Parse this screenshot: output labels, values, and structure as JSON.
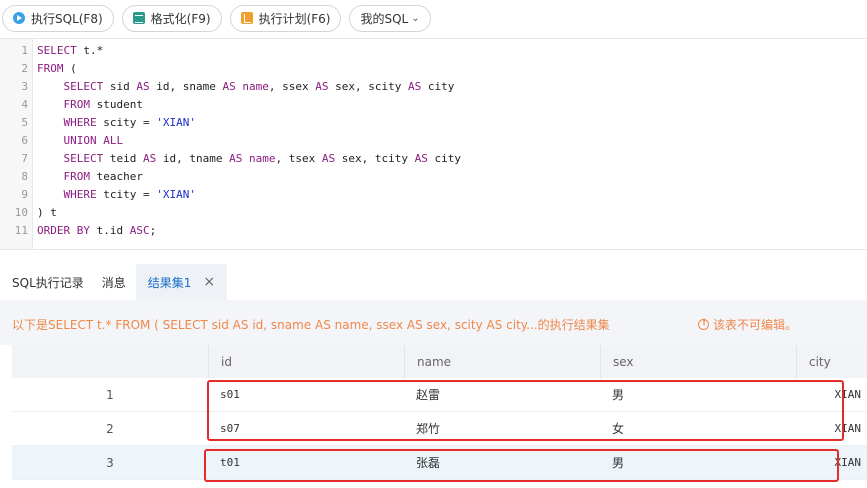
{
  "toolbar": {
    "run_label": "执行SQL(F8)",
    "format_label": "格式化(F9)",
    "plan_label": "执行计划(F6)",
    "mysql_label": "我的SQL"
  },
  "editor": {
    "lines": [
      {
        "n": "1",
        "tokens": [
          [
            "kw",
            "SELECT"
          ],
          [
            "t",
            " t.*"
          ]
        ]
      },
      {
        "n": "2",
        "tokens": [
          [
            "kw",
            "FROM"
          ],
          [
            "t",
            " ("
          ]
        ]
      },
      {
        "n": "3",
        "tokens": [
          [
            "t",
            "    "
          ],
          [
            "kw",
            "SELECT"
          ],
          [
            "t",
            " sid "
          ],
          [
            "kw",
            "AS"
          ],
          [
            "t",
            " id, sname "
          ],
          [
            "kw",
            "AS"
          ],
          [
            "t",
            " "
          ],
          [
            "kw",
            "name"
          ],
          [
            "t",
            ", ssex "
          ],
          [
            "kw",
            "AS"
          ],
          [
            "t",
            " sex, scity "
          ],
          [
            "kw",
            "AS"
          ],
          [
            "t",
            " city"
          ]
        ]
      },
      {
        "n": "4",
        "tokens": [
          [
            "t",
            "    "
          ],
          [
            "kw",
            "FROM"
          ],
          [
            "t",
            " student"
          ]
        ]
      },
      {
        "n": "5",
        "tokens": [
          [
            "t",
            "    "
          ],
          [
            "kw",
            "WHERE"
          ],
          [
            "t",
            " scity = "
          ],
          [
            "str",
            "'XIAN'"
          ]
        ]
      },
      {
        "n": "6",
        "tokens": [
          [
            "t",
            "    "
          ],
          [
            "kw",
            "UNION ALL"
          ]
        ]
      },
      {
        "n": "7",
        "tokens": [
          [
            "t",
            "    "
          ],
          [
            "kw",
            "SELECT"
          ],
          [
            "t",
            " teid "
          ],
          [
            "kw",
            "AS"
          ],
          [
            "t",
            " id, tname "
          ],
          [
            "kw",
            "AS"
          ],
          [
            "t",
            " "
          ],
          [
            "kw",
            "name"
          ],
          [
            "t",
            ", tsex "
          ],
          [
            "kw",
            "AS"
          ],
          [
            "t",
            " sex, tcity "
          ],
          [
            "kw",
            "AS"
          ],
          [
            "t",
            " city"
          ]
        ]
      },
      {
        "n": "8",
        "tokens": [
          [
            "t",
            "    "
          ],
          [
            "kw",
            "FROM"
          ],
          [
            "t",
            " teacher"
          ]
        ]
      },
      {
        "n": "9",
        "tokens": [
          [
            "t",
            "    "
          ],
          [
            "kw",
            "WHERE"
          ],
          [
            "t",
            " tcity = "
          ],
          [
            "str",
            "'XIAN'"
          ]
        ]
      },
      {
        "n": "10",
        "tokens": [
          [
            "t",
            ") t"
          ]
        ]
      },
      {
        "n": "11",
        "tokens": [
          [
            "kw",
            "ORDER BY"
          ],
          [
            "t",
            " t.id "
          ],
          [
            "kw",
            "ASC"
          ],
          [
            "t",
            ";"
          ]
        ]
      }
    ]
  },
  "tabs": {
    "history": "SQL执行记录",
    "messages": "消息",
    "result1": "结果集1",
    "close": "×"
  },
  "result": {
    "message": "以下是SELECT t.* FROM ( SELECT sid AS id, sname AS name, ssex AS sex, scity AS city...的执行结果集",
    "readonly": "该表不可编辑。",
    "columns": [
      "",
      "id",
      "name",
      "sex",
      "city"
    ],
    "rows": [
      [
        "1",
        "s01",
        "赵雷",
        "男",
        "XIAN"
      ],
      [
        "2",
        "s07",
        "郑竹",
        "女",
        "XIAN"
      ],
      [
        "3",
        "t01",
        "张磊",
        "男",
        "XIAN"
      ]
    ]
  },
  "colors": {
    "highlight": "#e52a2a",
    "accent": "#1a6fc9",
    "warning": "#f0884a"
  }
}
